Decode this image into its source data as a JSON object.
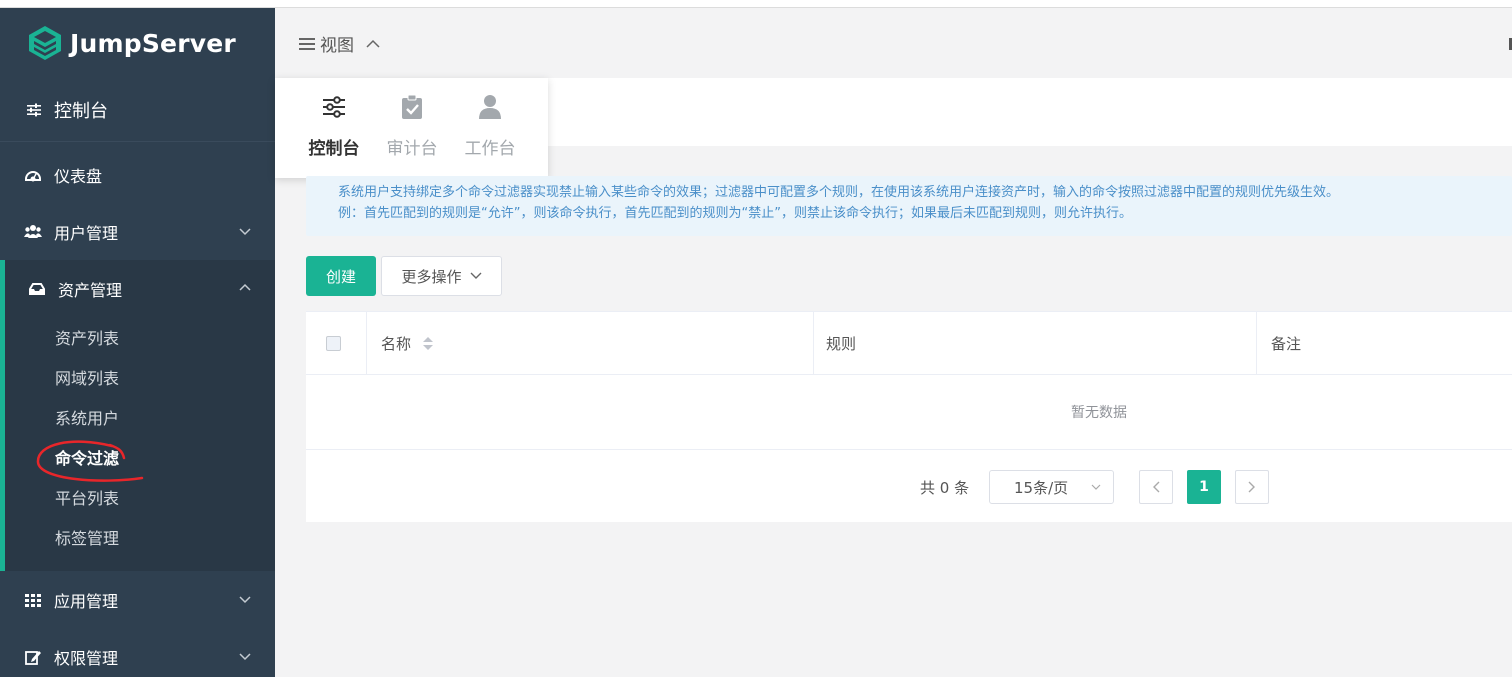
{
  "app": {
    "name": "JumpServer"
  },
  "sidebar": {
    "console_label": "控制台",
    "items": [
      {
        "label": "仪表盘",
        "icon": "dashboard-icon"
      },
      {
        "label": "用户管理",
        "icon": "users-icon"
      },
      {
        "label": "资产管理",
        "icon": "inbox-icon"
      },
      {
        "label": "应用管理",
        "icon": "grid-icon"
      },
      {
        "label": "权限管理",
        "icon": "edit-icon"
      }
    ],
    "asset_sub": [
      {
        "label": "资产列表"
      },
      {
        "label": "网域列表"
      },
      {
        "label": "系统用户"
      },
      {
        "label": "命令过滤"
      },
      {
        "label": "平台列表"
      },
      {
        "label": "标签管理"
      }
    ]
  },
  "header": {
    "view_label": "视图"
  },
  "view_menu": {
    "options": [
      {
        "label": "控制台",
        "icon": "sliders-icon"
      },
      {
        "label": "审计台",
        "icon": "clipboard-check-icon"
      },
      {
        "label": "工作台",
        "icon": "user-icon"
      }
    ]
  },
  "alert": {
    "line1": "系统用户支持绑定多个命令过滤器实现禁止输入某些命令的效果；过滤器中可配置多个规则，在使用该系统用户连接资产时，输入的命令按照过滤器中配置的规则优先级生效。",
    "line2": "例：首先匹配到的规则是“允许”，则该命令执行，首先匹配到的规则为“禁止”，则禁止该命令执行；如果最后未匹配到规则，则允许执行。"
  },
  "toolbar": {
    "create_label": "创建",
    "more_label": "更多操作"
  },
  "table": {
    "columns": [
      "名称",
      "规则",
      "备注"
    ],
    "empty_text": "暂无数据"
  },
  "pagination": {
    "total_text": "共 0 条",
    "page_size": "15条/页",
    "current_page": "1"
  },
  "colors": {
    "accent": "#1ab394",
    "sidebar": "#2f4050",
    "alert_text": "#4a8fc9"
  }
}
